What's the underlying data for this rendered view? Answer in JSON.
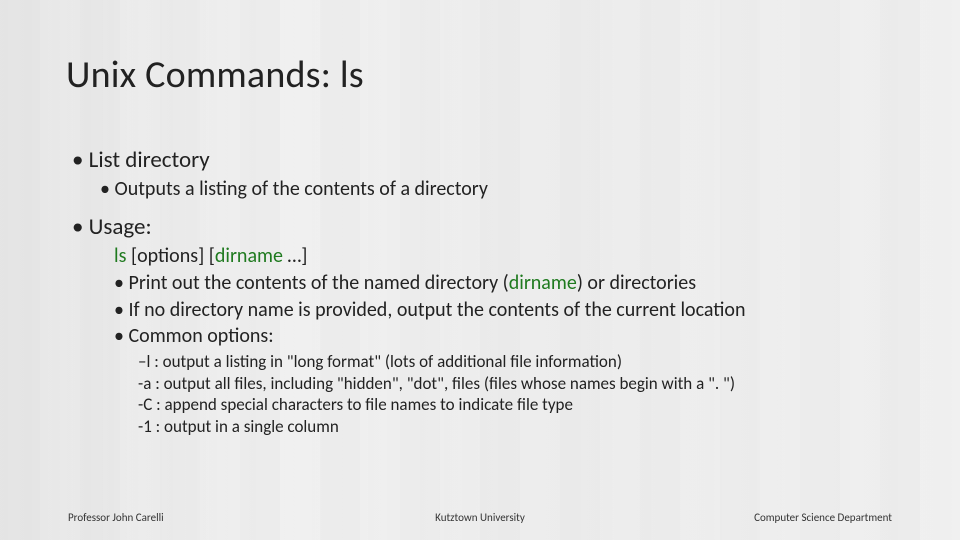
{
  "title": "Unix Commands: ls",
  "bullets": {
    "list_directory": "List directory",
    "outputs": "Outputs a listing of the contents of a directory",
    "usage": "Usage:",
    "usage_line_cmd": "ls",
    "usage_line_args": "  [options] [",
    "usage_line_dirname": "dirname",
    "usage_line_tail": " …]",
    "print_contents_a": "Print out the contents of the named directory (",
    "print_contents_dirname": "dirname",
    "print_contents_b": ") or directories",
    "no_dir": "If no directory name is provided, output the contents of the current location",
    "common_options": "Common options:",
    "opt_l": "–l : output a listing in \"long format\" (lots of additional file information)",
    "opt_a": "-a :  output all files, including \"hidden\", \"dot\", files (files whose names begin with a \". \")",
    "opt_C": "-C : append special characters to file names to indicate file type",
    "opt_1": "-1 : output in a single column"
  },
  "footer": {
    "left": "Professor John Carelli",
    "center": "Kutztown University",
    "right": "Computer Science Department"
  }
}
